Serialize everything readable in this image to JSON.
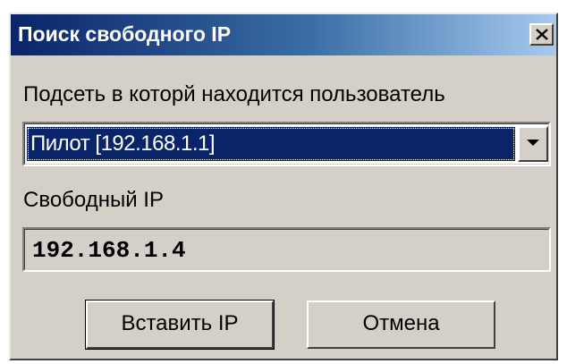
{
  "window": {
    "title": "Поиск свободного IP"
  },
  "subnet": {
    "label": "Подсеть в которй находится пользователь",
    "selected": "Пилот [192.168.1.1]"
  },
  "free_ip": {
    "label": "Свободный IP",
    "value": "192.168.1.4"
  },
  "buttons": {
    "insert_label": "Вставить IP",
    "cancel_label": "Отмена"
  },
  "icons": {
    "close": "close-icon",
    "dropdown": "chevron-down-icon"
  },
  "colors": {
    "title_start": "#0a246a",
    "title_end": "#a6caf0",
    "face": "#d4d0c8",
    "selection": "#0a246a"
  }
}
